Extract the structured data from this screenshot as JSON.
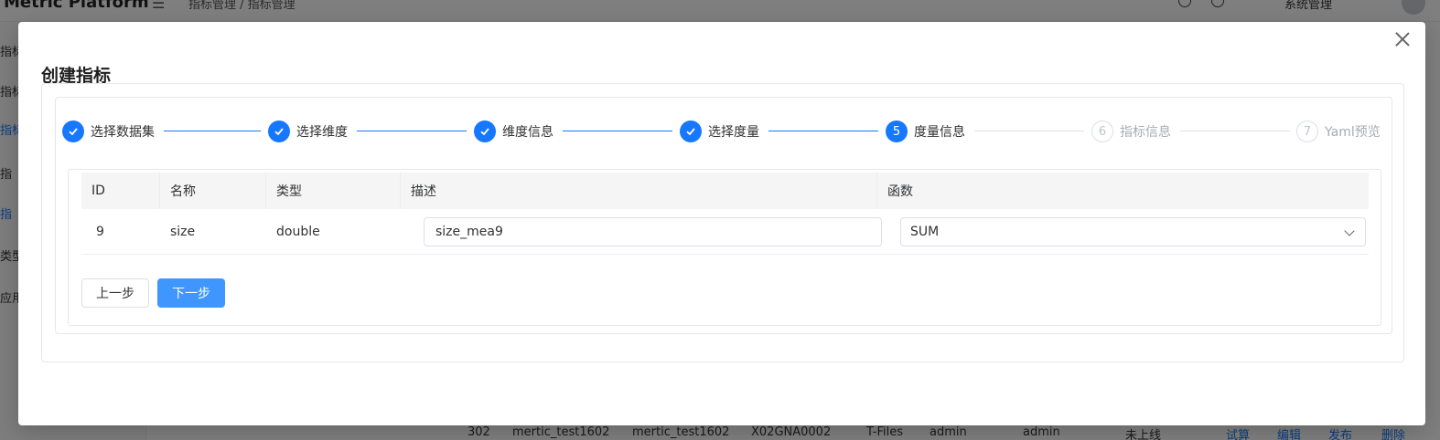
{
  "background": {
    "app_title": "Metric Platform",
    "breadcrumbs": "指标管理  /  指标管理",
    "user_label": "系统管理",
    "sidebar_items": [
      "指标",
      "指标",
      "指标",
      "指",
      "指",
      "类型",
      "应用"
    ],
    "table_row": {
      "id": "302",
      "name": "mertic_test1602",
      "code": "mertic_test1602",
      "no": "X02GNA0002",
      "source": "T-Files",
      "creator": "admin",
      "owner": "admin",
      "status": "未上线",
      "actions": [
        "试算",
        "编辑",
        "发布",
        "删除"
      ]
    }
  },
  "modal": {
    "title": "创建指标",
    "steps": [
      {
        "number": "1",
        "label": "选择数据集",
        "state": "done"
      },
      {
        "number": "2",
        "label": "选择维度",
        "state": "done"
      },
      {
        "number": "3",
        "label": "维度信息",
        "state": "done"
      },
      {
        "number": "4",
        "label": "选择度量",
        "state": "done"
      },
      {
        "number": "5",
        "label": "度量信息",
        "state": "active"
      },
      {
        "number": "6",
        "label": "指标信息",
        "state": "wait"
      },
      {
        "number": "7",
        "label": "Yaml预览",
        "state": "wait"
      }
    ],
    "table": {
      "columns": [
        "ID",
        "名称",
        "类型",
        "描述",
        "函数"
      ],
      "rows": [
        {
          "id": "9",
          "name": "size",
          "type": "double",
          "description": "size_mea9",
          "function": "SUM"
        }
      ]
    },
    "buttons": {
      "prev": "上一步",
      "next": "下一步"
    }
  },
  "colors": {
    "primary": "#1677ff",
    "next_button": "#4096ff",
    "overlay": "rgba(0,0,0,0.5)"
  }
}
